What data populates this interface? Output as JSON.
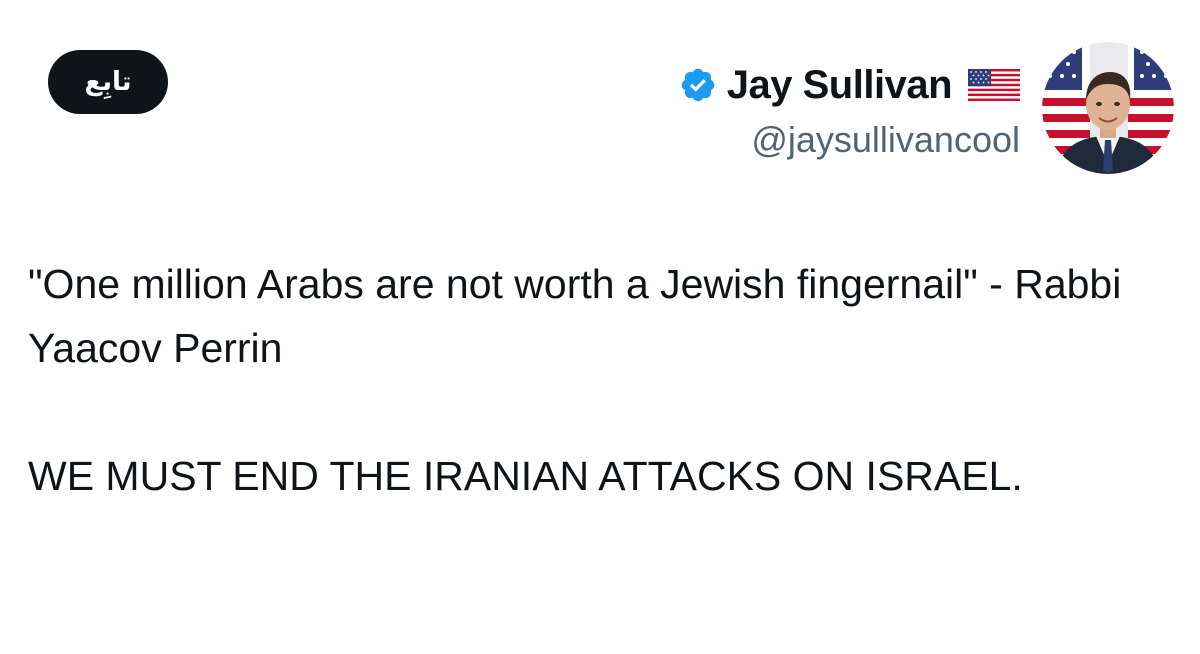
{
  "follow_button": {
    "label": "تابِع"
  },
  "author": {
    "display_name": "Jay Sullivan",
    "handle": "@jaysullivancool",
    "verified_icon": "verified-badge-icon",
    "flag_icon": "us-flag-icon",
    "verified_color": "#1d9bf0"
  },
  "tweet": {
    "paragraphs": [
      "\"One million Arabs are not worth a Jewish fingernail\" - Rabbi Yaacov Perrin",
      "WE MUST END THE IRANIAN ATTACKS ON ISRAEL."
    ]
  }
}
